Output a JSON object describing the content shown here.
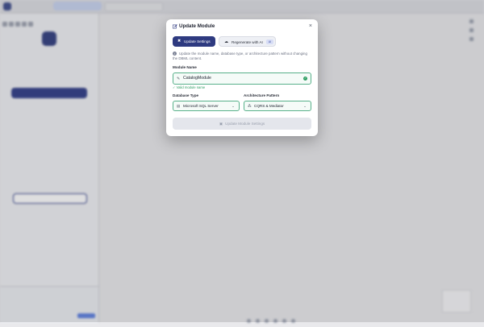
{
  "modal": {
    "title": "Update Module",
    "close_glyph": "×",
    "tabs": [
      {
        "label": "Update Settings",
        "icon": "wrench-icon",
        "glyph": "✖",
        "active": true
      },
      {
        "label": "Regenerate with AI",
        "icon": "robot-icon",
        "glyph": "☁",
        "badge": "AI",
        "active": false
      }
    ],
    "info_text": "Update the module name, database type, or architecture pattern without changing the DBML content.",
    "module_name": {
      "label": "Module Name",
      "value": "CatalogModule",
      "validation": "✓ Valid module name"
    },
    "database_type": {
      "label": "Database Type",
      "value": "Microsoft SQL Server",
      "icon": "database-icon",
      "glyph": "▤"
    },
    "architecture_pattern": {
      "label": "Architecture Pattern",
      "value": "CQRS & Mediator",
      "icon": "sitemap-icon",
      "glyph": "⁂"
    },
    "submit_label": "Update Module Settings",
    "submit_glyph": "▣"
  },
  "colors": {
    "primary": "#2e3a80",
    "success": "#2e9e62",
    "valid_border": "#58b08a"
  }
}
